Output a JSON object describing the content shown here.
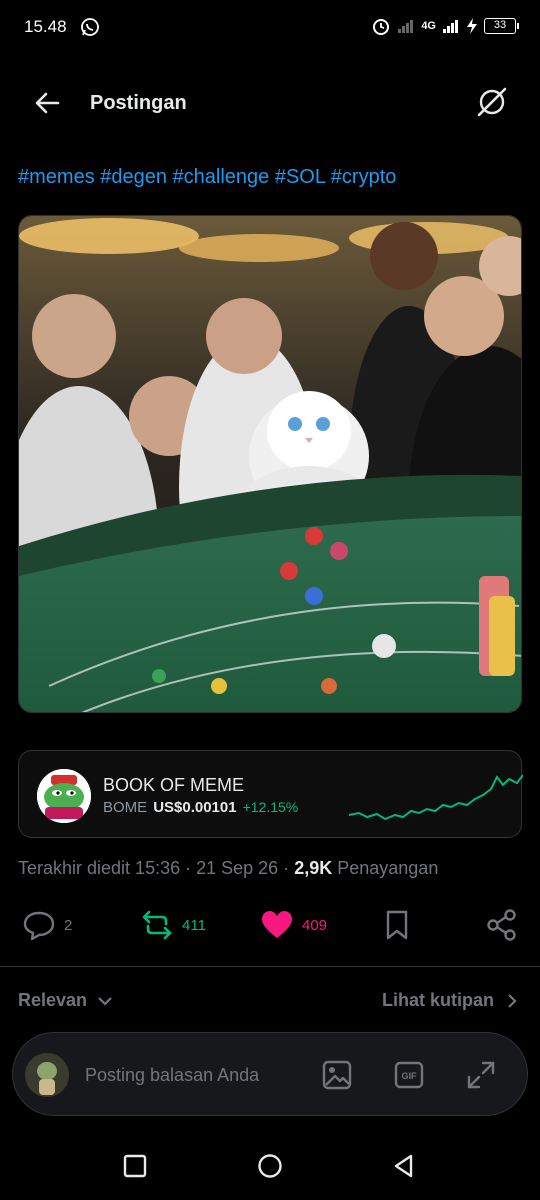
{
  "status_bar": {
    "time": "15.48",
    "network": "4G",
    "battery": "33"
  },
  "header": {
    "title": "Postingan"
  },
  "post": {
    "hashtags": "#memes #degen #challenge #SOL #crypto",
    "image_alt": "Cat in white hoodie at craps table with cheering crowd"
  },
  "token": {
    "name": "BOOK OF MEME",
    "ticker": "BOME",
    "price": "US$0.00101",
    "change": "+12.15%",
    "colors": {
      "up": "#00ba7c"
    }
  },
  "meta": {
    "edited_label": "Terakhir diedit 15:36 · 21 Sep 26 ·",
    "views_count": "2,9K",
    "views_label": "Penayangan"
  },
  "actions": {
    "replies": "2",
    "retweets": "411",
    "likes": "409"
  },
  "sort": {
    "relevance_label": "Relevan",
    "quotes_label": "Lihat kutipan"
  },
  "reply": {
    "placeholder": "Posting balasan Anda"
  },
  "colors": {
    "accent": "#1d9bf0",
    "like": "#f91880",
    "retweet": "#00ba7c",
    "background": "#000000"
  }
}
